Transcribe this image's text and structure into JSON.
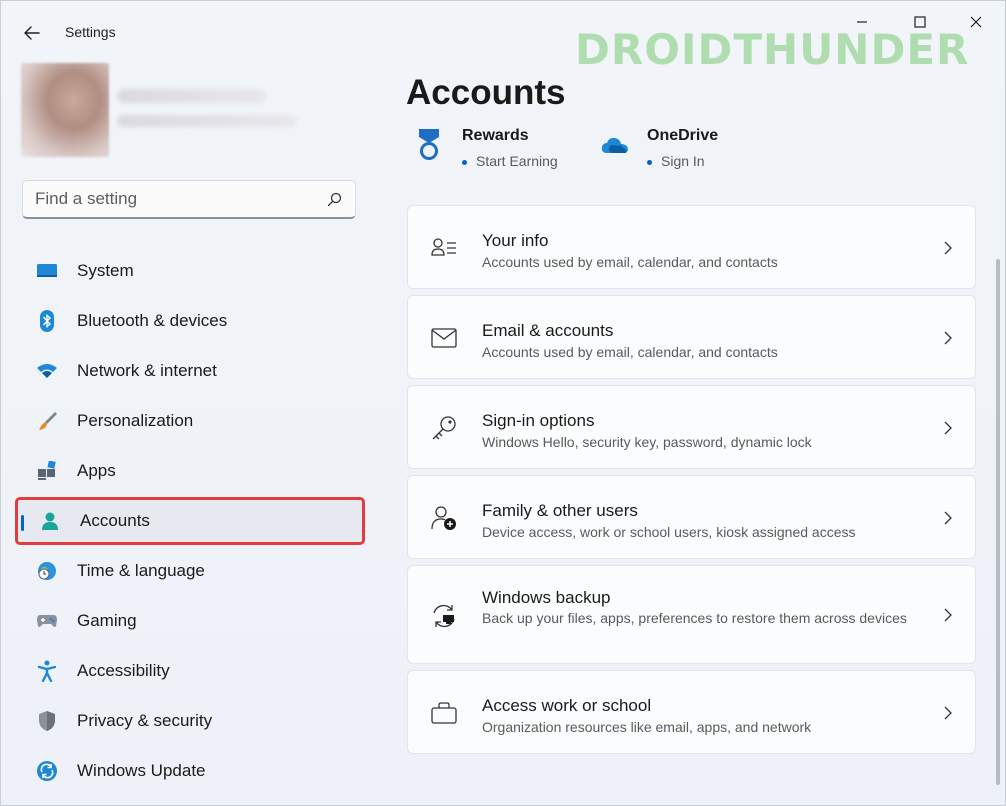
{
  "window": {
    "title": "Settings",
    "watermark": "DROIDTHUNDER"
  },
  "search": {
    "placeholder": "Find a setting"
  },
  "sidebar": {
    "items": [
      {
        "label": "System",
        "icon": "system-icon"
      },
      {
        "label": "Bluetooth & devices",
        "icon": "bluetooth-icon"
      },
      {
        "label": "Network & internet",
        "icon": "wifi-icon"
      },
      {
        "label": "Personalization",
        "icon": "brush-icon"
      },
      {
        "label": "Apps",
        "icon": "apps-icon"
      },
      {
        "label": "Accounts",
        "icon": "accounts-icon",
        "selected": true
      },
      {
        "label": "Time & language",
        "icon": "globe-clock-icon"
      },
      {
        "label": "Gaming",
        "icon": "gamepad-icon"
      },
      {
        "label": "Accessibility",
        "icon": "accessibility-icon"
      },
      {
        "label": "Privacy & security",
        "icon": "shield-icon"
      },
      {
        "label": "Windows Update",
        "icon": "update-icon"
      }
    ]
  },
  "main": {
    "title": "Accounts",
    "quick_links": [
      {
        "title": "Rewards",
        "sub": "Start Earning",
        "icon": "rewards-icon"
      },
      {
        "title": "OneDrive",
        "sub": "Sign In",
        "icon": "onedrive-icon"
      }
    ],
    "cards": [
      {
        "title": "Your info",
        "sub": "Accounts used by email, calendar, and contacts",
        "icon": "user-info-icon"
      },
      {
        "title": "Email & accounts",
        "sub": "Accounts used by email, calendar, and contacts",
        "icon": "mail-icon"
      },
      {
        "title": "Sign-in options",
        "sub": "Windows Hello, security key, password, dynamic lock",
        "icon": "key-icon"
      },
      {
        "title": "Family & other users",
        "sub": "Device access, work or school users, kiosk assigned access",
        "icon": "add-person-icon"
      },
      {
        "title": "Windows backup",
        "sub": "Back up your files, apps, preferences to restore them across devices",
        "icon": "backup-icon"
      },
      {
        "title": "Access work or school",
        "sub": "Organization resources like email, apps, and network",
        "icon": "briefcase-icon"
      }
    ]
  },
  "colors": {
    "accent": "#0067c0",
    "highlight_border": "#e03e3e",
    "watermark": "#a5d9a3"
  }
}
